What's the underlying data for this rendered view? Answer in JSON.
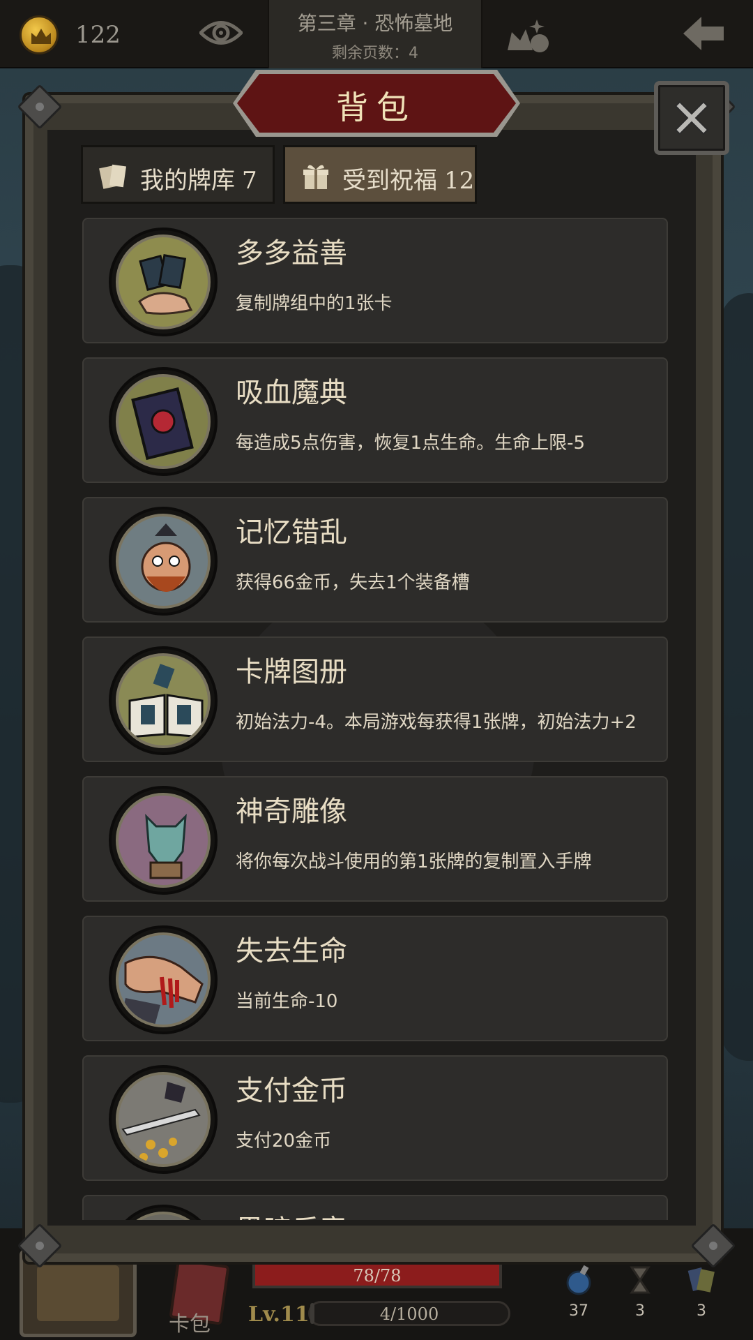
{
  "topbar": {
    "coins": "122",
    "chapter": "第三章 · 恐怖墓地",
    "pages_left": "剩余页数：4"
  },
  "panel": {
    "title": "背包",
    "tabs": [
      {
        "label": "我的牌库",
        "count": "7"
      },
      {
        "label": "受到祝福",
        "count": "12"
      }
    ],
    "selected_tab": "受到祝福"
  },
  "blessings": [
    {
      "name": "多多益善",
      "desc": "复制牌组中的1张卡",
      "icon": "hand-cards-icon",
      "bg": "#8e8c4e"
    },
    {
      "name": "吸血魔典",
      "desc": "每造成5点伤害，恢复1点生命。生命上限-5",
      "icon": "vampire-book-icon",
      "bg": "#80804a"
    },
    {
      "name": "记忆错乱",
      "desc": "获得66金币，失去1个装备槽",
      "icon": "confused-man-icon",
      "bg": "#6f7d82"
    },
    {
      "name": "卡牌图册",
      "desc": "初始法力-4。本局游戏每获得1张牌，初始法力+2",
      "icon": "card-album-icon",
      "bg": "#8a8a55"
    },
    {
      "name": "神奇雕像",
      "desc": "将你每次战斗使用的第1张牌的复制置入手牌",
      "icon": "gargoyle-statue-icon",
      "bg": "#8a6a80"
    },
    {
      "name": "失去生命",
      "desc": "当前生命-10",
      "icon": "bleeding-arm-icon",
      "bg": "#6c7a84"
    },
    {
      "name": "支付金币",
      "desc": "支付20金币",
      "icon": "coins-sword-icon",
      "bg": "#7c7a74"
    },
    {
      "name": "黑暗乐章",
      "desc": "",
      "icon": "partial-icon",
      "bg": "#6a6860"
    }
  ],
  "hud": {
    "deck_label": "卡包",
    "hp": "78/78",
    "hp_fraction": 1.0,
    "level": "Lv.11",
    "xp": "4/1000",
    "xp_fraction": 0.004,
    "potions": "37",
    "hourglass": "3",
    "cards": "3"
  },
  "colors": {
    "accent_red": "#8c1c1c",
    "plaque": "#5e1414",
    "card_bg": "#2d2c2a",
    "text": "#e8ddc4"
  }
}
